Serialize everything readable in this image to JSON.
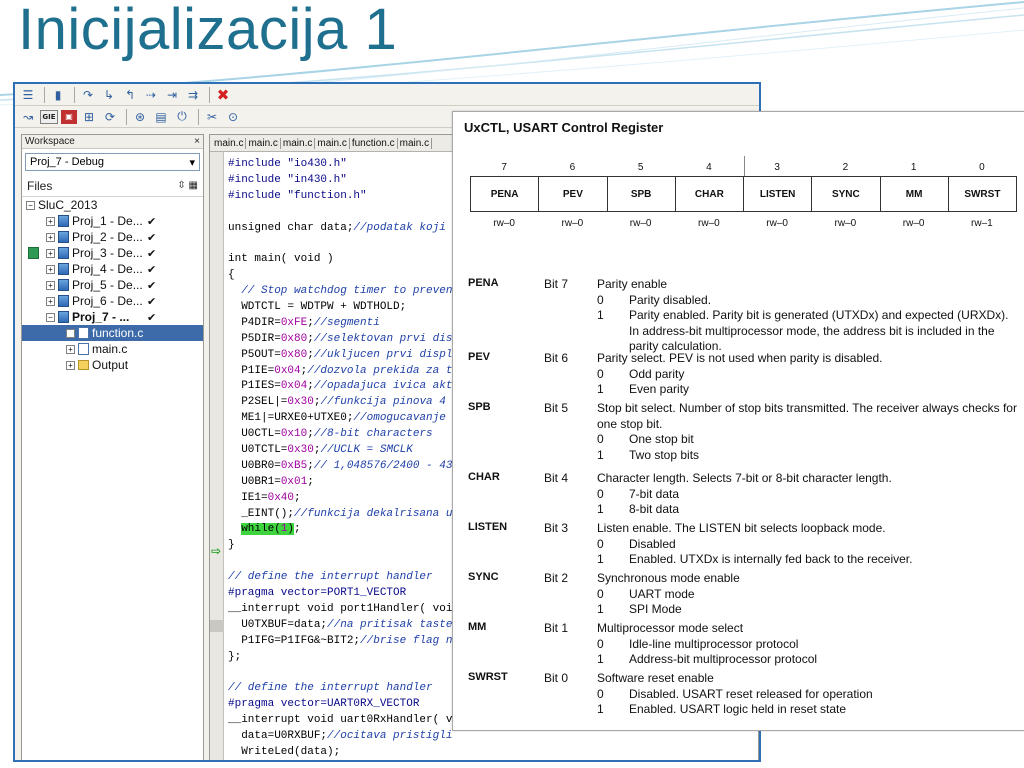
{
  "slide": {
    "title": "Inicijalizacija 1"
  },
  "workspace": {
    "header": "Workspace",
    "close": "×",
    "config": "Proj_7 - Debug",
    "files_label": "Files",
    "tree": [
      {
        "label": "SluC_2013",
        "level": 0,
        "expander": "⊟",
        "icon": "workspace",
        "check": ""
      },
      {
        "label": "Proj_1 - De...",
        "level": 1,
        "expander": "⊞",
        "icon": "project",
        "check": "✔"
      },
      {
        "label": "Proj_2 - De...",
        "level": 1,
        "expander": "⊞",
        "icon": "project",
        "check": "✔"
      },
      {
        "label": "Proj_3 - De...",
        "level": 1,
        "expander": "⊞",
        "icon": "project",
        "check": "✔"
      },
      {
        "label": "Proj_4 - De...",
        "level": 1,
        "expander": "⊞",
        "icon": "project",
        "check": "✔"
      },
      {
        "label": "Proj_5 - De...",
        "level": 1,
        "expander": "⊞",
        "icon": "project",
        "check": "✔"
      },
      {
        "label": "Proj_6 - De...",
        "level": 1,
        "expander": "⊞",
        "icon": "project",
        "check": "✔"
      },
      {
        "label": "Proj_7 - ...",
        "level": 1,
        "expander": "⊟",
        "icon": "project",
        "check": "✔",
        "bold": true
      },
      {
        "label": "function.c",
        "level": 2,
        "expander": "⊞",
        "icon": "cfile",
        "check": "",
        "selected": true
      },
      {
        "label": "main.c",
        "level": 2,
        "expander": "⊞",
        "icon": "cfile",
        "check": ""
      },
      {
        "label": "Output",
        "level": 2,
        "expander": "⊞",
        "icon": "folder",
        "check": ""
      }
    ]
  },
  "editor": {
    "tabs": [
      "main.c",
      "main.c",
      "main.c",
      "main.c",
      "function.c",
      "main.c"
    ],
    "lines": [
      "#include \"io430.h\"",
      "#include \"in430.h\"",
      "#include \"function.h\"",
      "",
      "unsigned char data;//podatak koji",
      "",
      "int main( void )",
      "{",
      "  // Stop watchdog timer to preven",
      "  WDTCTL = WDTPW + WDTHOLD;",
      "  P4DIR=0xFE;//segmenti",
      "  P5DIR=0x80;//selektovan prvi dis",
      "  P5OUT=0x80;//ukljucen prvi displ",
      "  P1IE=0x04;//dozvola prekida za t",
      "  P1IES=0x04;//opadajuca ivica akt",
      "  P2SEL|=0x30;//funkcija pinova 4",
      "  ME1|=URXE0+UTXE0;//omogucavanje",
      "  U0CTL=0x10;//8-bit characters",
      "  U0TCTL=0x30;//UCLK = SMCLK",
      "  U0BR0=0xB5;// 1,048576/2400 - 43",
      "  U0BR1=0x01;",
      "  IE1=0x40;",
      "  _EINT();//funkcija dekalrisana u",
      "  while(1);",
      "}",
      "",
      "// define the interrupt handler",
      "#pragma vector=PORT1_VECTOR",
      "__interrupt void port1Handler( voi",
      "  U0TXBUF=data;//na pritisak taste",
      "  P1IFG=P1IFG&~BIT2;//brise flag n",
      "};",
      "",
      "// define the interrupt handler",
      "#pragma vector=UART0RX_VECTOR",
      "__interrupt void uart0RxHandler( v",
      "  data=U0RXBUF;//ocitava pristigli",
      "  WriteLed(data);",
      "};"
    ]
  },
  "register": {
    "title": "UxCTL, USART Control Register",
    "bit_numbers": [
      "7",
      "6",
      "5",
      "4",
      "3",
      "2",
      "1",
      "0"
    ],
    "bit_names": [
      "PENA",
      "PEV",
      "SPB",
      "CHAR",
      "LISTEN",
      "SYNC",
      "MM",
      "SWRST"
    ],
    "access": [
      "rw–0",
      "rw–0",
      "rw–0",
      "rw–0",
      "rw–0",
      "rw–0",
      "rw–0",
      "rw–1"
    ],
    "descriptions": [
      {
        "name": "PENA",
        "bit": "Bit 7",
        "text": "Parity enable",
        "options": [
          [
            "0",
            "Parity disabled."
          ],
          [
            "1",
            "Parity enabled. Parity bit is generated (UTXDx) and expected (URXDx). In address-bit multiprocessor mode, the address bit is included in the parity calculation."
          ]
        ]
      },
      {
        "name": "PEV",
        "bit": "Bit 6",
        "text": "Parity select. PEV is not used when parity is disabled.",
        "options": [
          [
            "0",
            "Odd parity"
          ],
          [
            "1",
            "Even parity"
          ]
        ]
      },
      {
        "name": "SPB",
        "bit": "Bit 5",
        "text": "Stop bit select. Number of stop bits transmitted. The receiver always checks for one stop bit.",
        "options": [
          [
            "0",
            "One stop bit"
          ],
          [
            "1",
            "Two stop bits"
          ]
        ]
      },
      {
        "name": "CHAR",
        "bit": "Bit 4",
        "text": "Character length. Selects 7-bit or 8-bit character length.",
        "options": [
          [
            "0",
            "7-bit data"
          ],
          [
            "1",
            "8-bit data"
          ]
        ]
      },
      {
        "name": "LISTEN",
        "bit": "Bit 3",
        "text": "Listen enable. The LISTEN bit selects loopback mode.",
        "options": [
          [
            "0",
            "Disabled"
          ],
          [
            "1",
            "Enabled. UTXDx is internally fed back to the receiver."
          ]
        ]
      },
      {
        "name": "SYNC",
        "bit": "Bit 2",
        "text": "Synchronous mode enable",
        "options": [
          [
            "0",
            "UART mode"
          ],
          [
            "1",
            "SPI Mode"
          ]
        ]
      },
      {
        "name": "MM",
        "bit": "Bit 1",
        "text": "Multiprocessor mode select",
        "options": [
          [
            "0",
            "Idle-line multiprocessor protocol"
          ],
          [
            "1",
            "Address-bit multiprocessor protocol"
          ]
        ]
      },
      {
        "name": "SWRST",
        "bit": "Bit 0",
        "text": "Software reset enable",
        "options": [
          [
            "0",
            "Disabled. USART reset released for operation"
          ],
          [
            "1",
            "Enabled. USART logic held in reset state"
          ]
        ]
      }
    ]
  }
}
